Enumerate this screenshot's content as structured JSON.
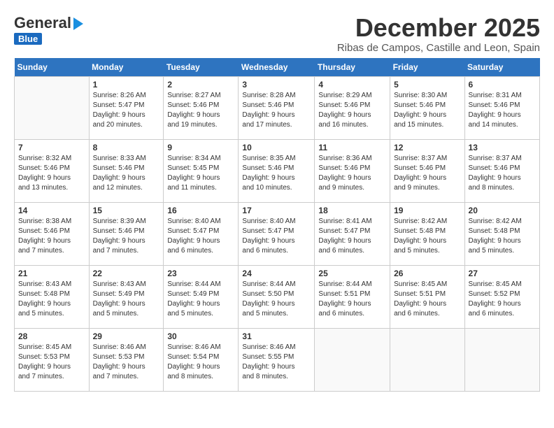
{
  "header": {
    "logo_general": "General",
    "logo_blue": "Blue",
    "month_title": "December 2025",
    "subtitle": "Ribas de Campos, Castille and Leon, Spain"
  },
  "weekdays": [
    "Sunday",
    "Monday",
    "Tuesday",
    "Wednesday",
    "Thursday",
    "Friday",
    "Saturday"
  ],
  "weeks": [
    [
      {
        "day": "",
        "info": ""
      },
      {
        "day": "1",
        "info": "Sunrise: 8:26 AM\nSunset: 5:47 PM\nDaylight: 9 hours\nand 20 minutes."
      },
      {
        "day": "2",
        "info": "Sunrise: 8:27 AM\nSunset: 5:46 PM\nDaylight: 9 hours\nand 19 minutes."
      },
      {
        "day": "3",
        "info": "Sunrise: 8:28 AM\nSunset: 5:46 PM\nDaylight: 9 hours\nand 17 minutes."
      },
      {
        "day": "4",
        "info": "Sunrise: 8:29 AM\nSunset: 5:46 PM\nDaylight: 9 hours\nand 16 minutes."
      },
      {
        "day": "5",
        "info": "Sunrise: 8:30 AM\nSunset: 5:46 PM\nDaylight: 9 hours\nand 15 minutes."
      },
      {
        "day": "6",
        "info": "Sunrise: 8:31 AM\nSunset: 5:46 PM\nDaylight: 9 hours\nand 14 minutes."
      }
    ],
    [
      {
        "day": "7",
        "info": "Sunrise: 8:32 AM\nSunset: 5:46 PM\nDaylight: 9 hours\nand 13 minutes."
      },
      {
        "day": "8",
        "info": "Sunrise: 8:33 AM\nSunset: 5:46 PM\nDaylight: 9 hours\nand 12 minutes."
      },
      {
        "day": "9",
        "info": "Sunrise: 8:34 AM\nSunset: 5:45 PM\nDaylight: 9 hours\nand 11 minutes."
      },
      {
        "day": "10",
        "info": "Sunrise: 8:35 AM\nSunset: 5:46 PM\nDaylight: 9 hours\nand 10 minutes."
      },
      {
        "day": "11",
        "info": "Sunrise: 8:36 AM\nSunset: 5:46 PM\nDaylight: 9 hours\nand 9 minutes."
      },
      {
        "day": "12",
        "info": "Sunrise: 8:37 AM\nSunset: 5:46 PM\nDaylight: 9 hours\nand 9 minutes."
      },
      {
        "day": "13",
        "info": "Sunrise: 8:37 AM\nSunset: 5:46 PM\nDaylight: 9 hours\nand 8 minutes."
      }
    ],
    [
      {
        "day": "14",
        "info": "Sunrise: 8:38 AM\nSunset: 5:46 PM\nDaylight: 9 hours\nand 7 minutes."
      },
      {
        "day": "15",
        "info": "Sunrise: 8:39 AM\nSunset: 5:46 PM\nDaylight: 9 hours\nand 7 minutes."
      },
      {
        "day": "16",
        "info": "Sunrise: 8:40 AM\nSunset: 5:47 PM\nDaylight: 9 hours\nand 6 minutes."
      },
      {
        "day": "17",
        "info": "Sunrise: 8:40 AM\nSunset: 5:47 PM\nDaylight: 9 hours\nand 6 minutes."
      },
      {
        "day": "18",
        "info": "Sunrise: 8:41 AM\nSunset: 5:47 PM\nDaylight: 9 hours\nand 6 minutes."
      },
      {
        "day": "19",
        "info": "Sunrise: 8:42 AM\nSunset: 5:48 PM\nDaylight: 9 hours\nand 5 minutes."
      },
      {
        "day": "20",
        "info": "Sunrise: 8:42 AM\nSunset: 5:48 PM\nDaylight: 9 hours\nand 5 minutes."
      }
    ],
    [
      {
        "day": "21",
        "info": "Sunrise: 8:43 AM\nSunset: 5:48 PM\nDaylight: 9 hours\nand 5 minutes."
      },
      {
        "day": "22",
        "info": "Sunrise: 8:43 AM\nSunset: 5:49 PM\nDaylight: 9 hours\nand 5 minutes."
      },
      {
        "day": "23",
        "info": "Sunrise: 8:44 AM\nSunset: 5:49 PM\nDaylight: 9 hours\nand 5 minutes."
      },
      {
        "day": "24",
        "info": "Sunrise: 8:44 AM\nSunset: 5:50 PM\nDaylight: 9 hours\nand 5 minutes."
      },
      {
        "day": "25",
        "info": "Sunrise: 8:44 AM\nSunset: 5:51 PM\nDaylight: 9 hours\nand 6 minutes."
      },
      {
        "day": "26",
        "info": "Sunrise: 8:45 AM\nSunset: 5:51 PM\nDaylight: 9 hours\nand 6 minutes."
      },
      {
        "day": "27",
        "info": "Sunrise: 8:45 AM\nSunset: 5:52 PM\nDaylight: 9 hours\nand 6 minutes."
      }
    ],
    [
      {
        "day": "28",
        "info": "Sunrise: 8:45 AM\nSunset: 5:53 PM\nDaylight: 9 hours\nand 7 minutes."
      },
      {
        "day": "29",
        "info": "Sunrise: 8:46 AM\nSunset: 5:53 PM\nDaylight: 9 hours\nand 7 minutes."
      },
      {
        "day": "30",
        "info": "Sunrise: 8:46 AM\nSunset: 5:54 PM\nDaylight: 9 hours\nand 8 minutes."
      },
      {
        "day": "31",
        "info": "Sunrise: 8:46 AM\nSunset: 5:55 PM\nDaylight: 9 hours\nand 8 minutes."
      },
      {
        "day": "",
        "info": ""
      },
      {
        "day": "",
        "info": ""
      },
      {
        "day": "",
        "info": ""
      }
    ]
  ]
}
